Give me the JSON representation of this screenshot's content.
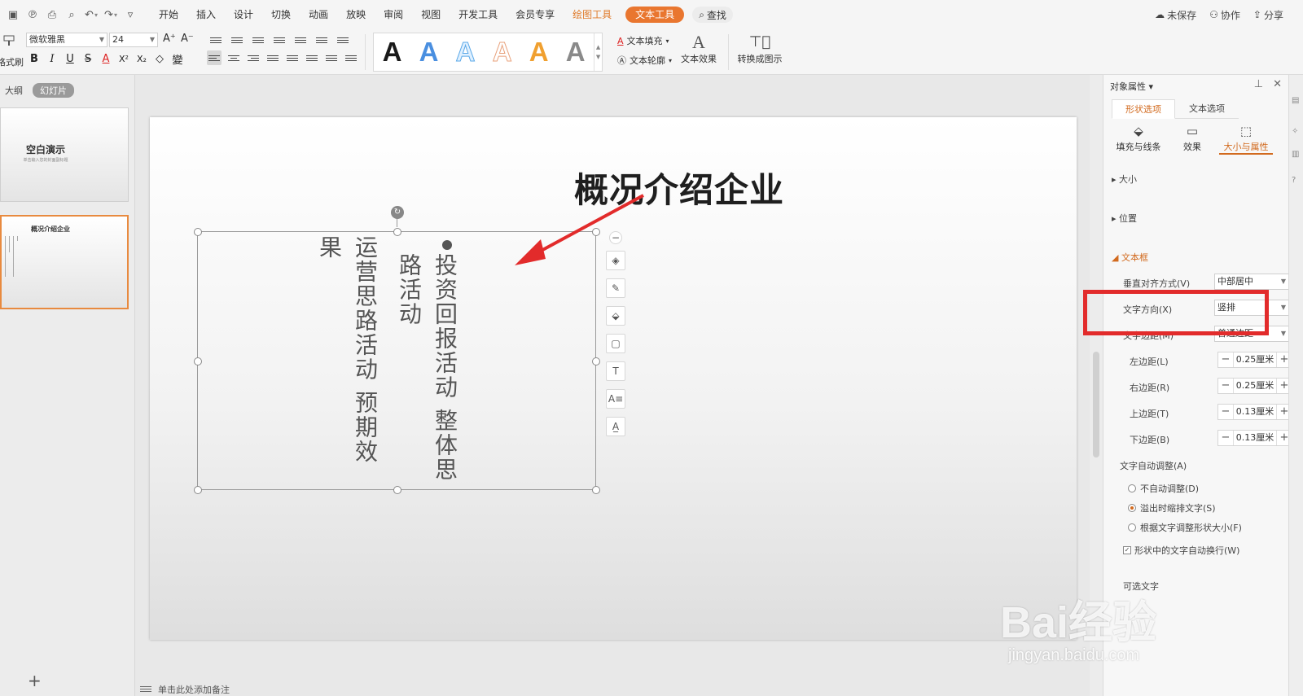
{
  "menubar": {
    "menus": [
      "开始",
      "插入",
      "设计",
      "切换",
      "动画",
      "放映",
      "审阅",
      "视图",
      "开发工具",
      "会员专享"
    ],
    "drawing_tools": "绘图工具",
    "text_tools": "文本工具",
    "search": "查找",
    "right": {
      "unsaved": "未保存",
      "collab": "协作",
      "share": "分享"
    }
  },
  "toolbar": {
    "format_painter": "格式刷",
    "font_name": "微软雅黑",
    "font_size": "24",
    "style_gallery": [
      "A",
      "A",
      "A",
      "A",
      "A",
      "A"
    ],
    "text_fill": "文本填充",
    "text_outline": "文本轮廓",
    "text_effect": "文本效果",
    "convert_smartart": "转换成图示",
    "colors": {
      "black": "#1a1a1a",
      "blue": "#4a8fe0",
      "outline_blue": "#5aa8e8",
      "outline_peach": "#e8a07a",
      "orange": "#f0a030",
      "gray": "#8a8a8a"
    }
  },
  "left_pane": {
    "tab_outline": "大纲",
    "tab_slides": "幻灯片",
    "slide1_title": "空白演示",
    "slide1_sub": "单击输入您的封面副标题",
    "slide2_title": "概况介绍企业",
    "add": "+"
  },
  "slide": {
    "title": "概况介绍企业",
    "columns": [
      "投资回报活动  整体思",
      "路活动",
      "运营思路活动  预期效",
      "果"
    ]
  },
  "notes": "单击此处添加备注",
  "panel": {
    "title": "对象属性",
    "tabs": [
      "形状选项",
      "文本选项"
    ],
    "subtabs": [
      "填充与线条",
      "效果",
      "大小与属性"
    ],
    "sections": {
      "size": "大小",
      "position": "位置",
      "textbox": "文本框"
    },
    "vertical_align_label": "垂直对齐方式(V)",
    "vertical_align_value": "中部居中",
    "text_dir_label": "文字方向(X)",
    "text_dir_value": "竖排",
    "margin_label": "文字边距(M)",
    "margin_value": "普通边距",
    "left_margin_label": "左边距(L)",
    "left_margin": "0.25厘米",
    "right_margin_label": "右边距(R)",
    "right_margin": "0.25厘米",
    "top_margin_label": "上边距(T)",
    "top_margin": "0.13厘米",
    "bottom_margin_label": "下边距(B)",
    "bottom_margin": "0.13厘米",
    "autofit_label": "文字自动调整(A)",
    "autofit_opts": [
      "不自动调整(D)",
      "溢出时缩排文字(S)",
      "根据文字调整形状大小(F)"
    ],
    "wrap_label": "形状中的文字自动换行(W)",
    "optional_text": "可选文字"
  },
  "watermark": {
    "brand": "Bai经验",
    "url": "jingyan.baidu.com"
  }
}
